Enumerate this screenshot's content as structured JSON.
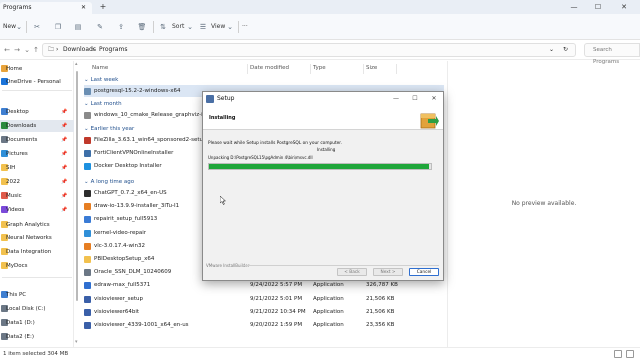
{
  "window": {
    "tab_title": "Programs",
    "tab_close": "✕",
    "new_tab": "+",
    "minimize": "—",
    "maximize": "☐",
    "close": "✕"
  },
  "toolbar": {
    "new_label": "New",
    "sort_label": "Sort",
    "view_label": "View",
    "more_label": "···"
  },
  "address": {
    "crumbs": [
      "Downloads",
      "Programs"
    ],
    "separator": "›",
    "search_placeholder": "Search Programs"
  },
  "sidebar": {
    "items": [
      {
        "label": "Home",
        "color": "#e8a33a",
        "pinned": false
      },
      {
        "label": "OneDrive - Personal",
        "color": "#1a73d9",
        "pinned": false
      },
      {
        "label": "Desktop",
        "color": "#3f7fd1",
        "pinned": true
      },
      {
        "label": "Downloads",
        "color": "#2b8a3e",
        "pinned": true
      },
      {
        "label": "Documents",
        "color": "#6b7785",
        "pinned": true
      },
      {
        "label": "Pictures",
        "color": "#2f8fd8",
        "pinned": true
      },
      {
        "label": "SIH",
        "color": "#f2c14e",
        "pinned": true
      },
      {
        "label": "2022",
        "color": "#f2c14e",
        "pinned": true
      },
      {
        "label": "Music",
        "color": "#e05a4a",
        "pinned": true
      },
      {
        "label": "Videos",
        "color": "#7b4ad9",
        "pinned": true
      },
      {
        "label": "Graph Analytics",
        "color": "#f2c14e",
        "pinned": false
      },
      {
        "label": "Neural Networks",
        "color": "#f2c14e",
        "pinned": false
      },
      {
        "label": "Data Integration",
        "color": "#f2c14e",
        "pinned": false
      },
      {
        "label": "MyDocs",
        "color": "#f2c14e",
        "pinned": false
      },
      {
        "label": "This PC",
        "color": "#3f7fd1",
        "pinned": false
      },
      {
        "label": "Local Disk (C:)",
        "color": "#6b7785",
        "pinned": false
      },
      {
        "label": "Data1 (D:)",
        "color": "#6b7785",
        "pinned": false
      },
      {
        "label": "Data2 (E:)",
        "color": "#6b7785",
        "pinned": false
      }
    ]
  },
  "columns": {
    "name": "Name",
    "date": "Date modified",
    "type": "Type",
    "size": "Size"
  },
  "groups": {
    "last_week": "Last week",
    "last_month": "Last month",
    "earlier_year": "Earlier this year",
    "long_ago": "A long time ago"
  },
  "files": {
    "last_week": [
      {
        "name": "postgresql-15.2-2-windows-x64",
        "date": "",
        "type": "",
        "size": "",
        "color": "#6b8fb3"
      }
    ],
    "last_month": [
      {
        "name": "windows_10_cmake_Release_graphviz-install-7...",
        "date": "",
        "type": "",
        "size": "",
        "color": "#8a8a8a"
      }
    ],
    "earlier_year": [
      {
        "name": "FileZilla_3.63.1_win64_sponsored2-setup",
        "date": "",
        "type": "",
        "size": "",
        "color": "#c0392b"
      },
      {
        "name": "FortiClientVPNOnlineInstaller",
        "date": "",
        "type": "",
        "size": "",
        "color": "#3d6fa8"
      },
      {
        "name": "Docker Desktop Installer",
        "date": "",
        "type": "",
        "size": "",
        "color": "#1d91e0"
      }
    ],
    "long_ago": [
      {
        "name": "ChatGPT_0.7.2_x64_en-US",
        "date": "",
        "type": "",
        "size": "",
        "color": "#2d2d2d"
      },
      {
        "name": "draw-io-13.9.9-installer_3lTu-I1",
        "date": "",
        "type": "",
        "size": "",
        "color": "#e67e22"
      },
      {
        "name": "repairit_setup_full5913",
        "date": "",
        "type": "",
        "size": "",
        "color": "#3a7bd5"
      },
      {
        "name": "kernel-video-repair",
        "date": "",
        "type": "",
        "size": "",
        "color": "#2f8fd8"
      },
      {
        "name": "vlc-3.0.17.4-win32",
        "date": "",
        "type": "",
        "size": "",
        "color": "#e67e22"
      },
      {
        "name": "PBIDesktopSetup_x64",
        "date": "",
        "type": "",
        "size": "",
        "color": "#f2c14e"
      },
      {
        "name": "Oracle_SSN_DLM_10240609",
        "date": "",
        "type": "",
        "size": "",
        "color": "#6b7785"
      },
      {
        "name": "edraw-max_full5371",
        "date": "9/24/2022 5:57 PM",
        "type": "Application",
        "size": "326,787 KB",
        "color": "#2f6fd0"
      },
      {
        "name": "visioviewer_setup",
        "date": "9/21/2022 5:01 PM",
        "type": "Application",
        "size": "21,506 KB",
        "color": "#3a5fa8"
      },
      {
        "name": "visioviewer64bit",
        "date": "9/21/2022 10:34 PM",
        "type": "Application",
        "size": "21,506 KB",
        "color": "#3a5fa8"
      },
      {
        "name": "visioviewer_4339-1001_x64_en-us",
        "date": "9/20/2022 1:59 PM",
        "type": "Application",
        "size": "23,356 KB",
        "color": "#3a5fa8"
      }
    ]
  },
  "preview": {
    "text": "No preview available."
  },
  "status": {
    "items_text": "items",
    "selected_text": "1 item selected  304 MB"
  },
  "setup": {
    "title": "Setup",
    "header": "Installing",
    "message": "Please wait while Setup installs PostgreSQL on your computer.",
    "sub_status": "Installing",
    "unpacking": "Unpacking D:\\PostgreSQL15\\pgAdmin 4\\bin\\msvc.dll",
    "progress": 0.99,
    "footer": "VMware InstallBuilder",
    "back_label": "< Back",
    "next_label": "Next >",
    "cancel_label": "Cancel"
  },
  "colors": {
    "accent": "#2f6fd0",
    "progress": "#1fa63a",
    "selection": "#dbe6f4"
  }
}
